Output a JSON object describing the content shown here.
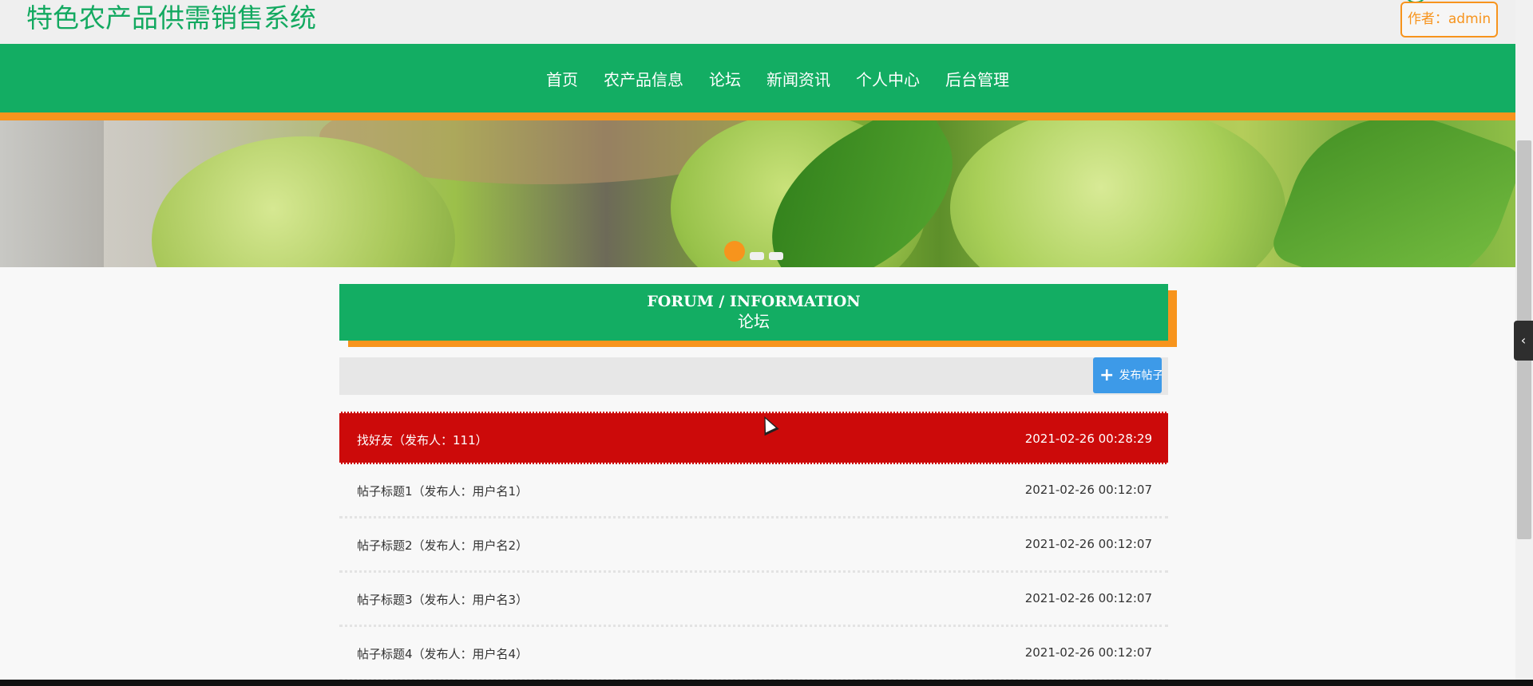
{
  "header": {
    "site_title": "特色农产品供需销售系统",
    "author_label": "作者：",
    "author_name": "admin"
  },
  "nav": {
    "items": [
      {
        "label": "首页"
      },
      {
        "label": "农产品信息"
      },
      {
        "label": "论坛"
      },
      {
        "label": "新闻资讯"
      },
      {
        "label": "个人中心"
      },
      {
        "label": "后台管理"
      }
    ]
  },
  "banner": {
    "slide_count": 3,
    "active_slide": 1
  },
  "section": {
    "title_en": "FORUM / INFORMATION",
    "title_cn": "论坛"
  },
  "toolbar": {
    "post_button_label": "发布帖子",
    "post_button_icon": "plus-icon"
  },
  "posts": [
    {
      "title": "找好友（发布人：111）",
      "time": "2021-02-26 00:28:29",
      "highlighted": true
    },
    {
      "title": "帖子标题1（发布人：用户名1）",
      "time": "2021-02-26 00:12:07"
    },
    {
      "title": "帖子标题2（发布人：用户名2）",
      "time": "2021-02-26 00:12:07"
    },
    {
      "title": "帖子标题3（发布人：用户名3）",
      "time": "2021-02-26 00:12:07"
    },
    {
      "title": "帖子标题4（发布人：用户名4）",
      "time": "2021-02-26 00:12:07"
    }
  ],
  "colors": {
    "brand_green": "#13ad63",
    "accent_orange": "#f7941d",
    "highlight_red": "#cc0a0a",
    "button_blue": "#3d9ae8"
  },
  "side_tab_icon": "chevron-left-icon"
}
